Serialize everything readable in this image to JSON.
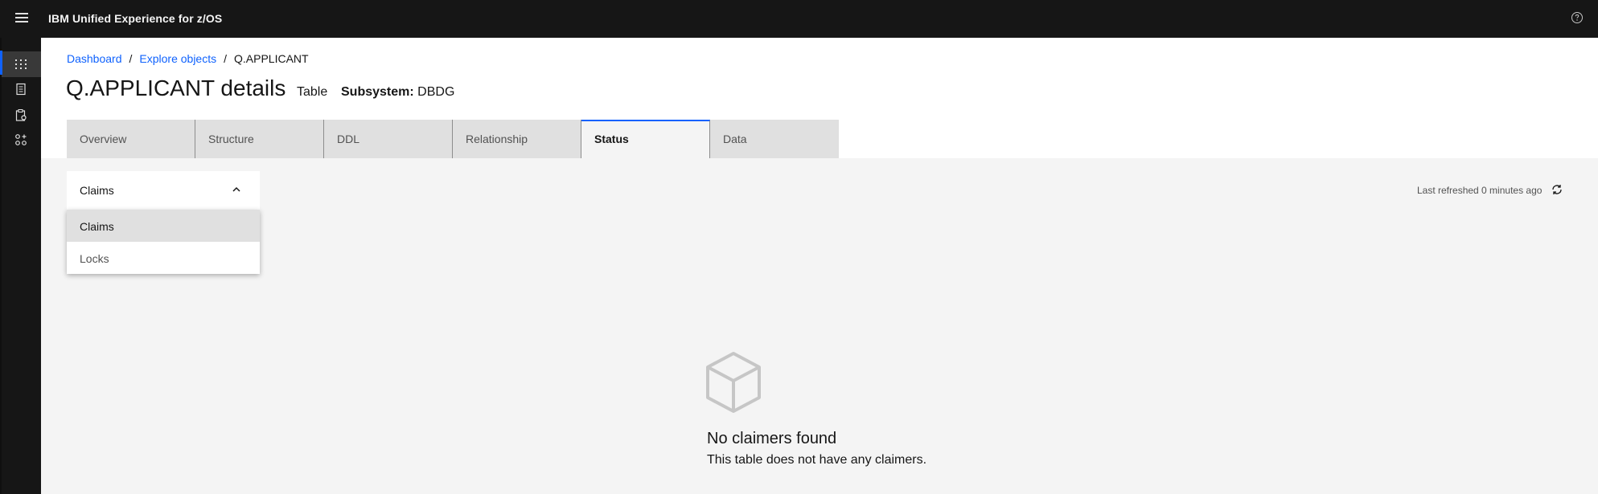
{
  "app": {
    "title": "IBM Unified Experience for z/OS"
  },
  "icons": {
    "menu": "hamburger-menu-icon",
    "help": "help-icon",
    "nav": [
      "grid-icon",
      "document-icon",
      "clipboard-gear-icon",
      "apps-icon"
    ],
    "dropdown": "chevron-up-icon",
    "refresh": "refresh-icon",
    "empty": "cube-icon"
  },
  "breadcrumb": {
    "items": [
      "Dashboard",
      "Explore objects"
    ],
    "current": "Q.APPLICANT",
    "separator": "/"
  },
  "header": {
    "title": "Q.APPLICANT details",
    "type": "Table",
    "subsystem_label": "Subsystem:",
    "subsystem_value": "DBDG"
  },
  "tabs": [
    "Overview",
    "Structure",
    "DDL",
    "Relationship",
    "Status",
    "Data"
  ],
  "selected_tab": "Status",
  "dropdown": {
    "value": "Claims",
    "options": [
      "Claims",
      "Locks"
    ]
  },
  "refresh": {
    "text": "Last refreshed 0 minutes ago"
  },
  "empty_state": {
    "title": "No claimers found",
    "description": "This table does not have any claimers."
  },
  "colors": {
    "accent": "#0f62fe",
    "shell": "#161616",
    "background": "#f4f4f4"
  }
}
